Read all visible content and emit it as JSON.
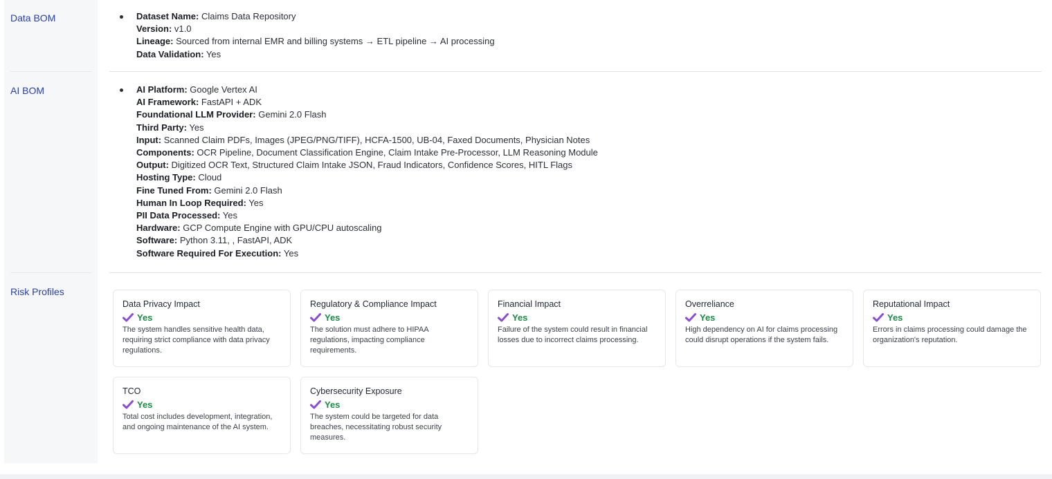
{
  "sections": {
    "data_bom_label": "Data BOM",
    "ai_bom_label": "AI BOM",
    "risk_profiles_label": "Risk Profiles"
  },
  "data_bom": [
    {
      "key": "Dataset Name:",
      "value": " Claims Data Repository"
    },
    {
      "key": "Version:",
      "value": " v1.0"
    },
    {
      "key": "Lineage:",
      "value": " Sourced from internal EMR and billing systems → ETL pipeline → AI processing"
    },
    {
      "key": "Data Validation:",
      "value": " Yes"
    }
  ],
  "ai_bom": [
    {
      "key": "AI Platform:",
      "value": " Google Vertex AI"
    },
    {
      "key": "AI Framework:",
      "value": " FastAPI + ADK"
    },
    {
      "key": "Foundational LLM Provider:",
      "value": " Gemini 2.0 Flash"
    },
    {
      "key": "Third Party:",
      "value": " Yes"
    },
    {
      "key": "Input:",
      "value": " Scanned Claim PDFs, Images (JPEG/PNG/TIFF), HCFA-1500, UB-04, Faxed Documents, Physician Notes"
    },
    {
      "key": "Components:",
      "value": " OCR Pipeline, Document Classification Engine, Claim Intake Pre-Processor, LLM Reasoning Module"
    },
    {
      "key": "Output:",
      "value": " Digitized OCR Text, Structured Claim Intake JSON, Fraud Indicators, Confidence Scores, HITL Flags"
    },
    {
      "key": "Hosting Type:",
      "value": " Cloud"
    },
    {
      "key": "Fine Tuned From:",
      "value": " Gemini 2.0 Flash"
    },
    {
      "key": "Human In Loop Required:",
      "value": " Yes"
    },
    {
      "key": "PII Data Processed:",
      "value": " Yes"
    },
    {
      "key": "Hardware:",
      "value": " GCP Compute Engine with GPU/CPU autoscaling"
    },
    {
      "key": "Software:",
      "value": " Python 3.11, , FastAPI, ADK"
    },
    {
      "key": "Software Required For Execution:",
      "value": " Yes"
    }
  ],
  "risk_profiles": [
    {
      "title": "Data Privacy Impact",
      "status": "Yes",
      "desc": "The system handles sensitive health data, requiring strict compliance with data privacy regulations."
    },
    {
      "title": "Regulatory & Compliance Impact",
      "status": "Yes",
      "desc": "The solution must adhere to HIPAA regulations, impacting compliance requirements."
    },
    {
      "title": "Financial Impact",
      "status": "Yes",
      "desc": "Failure of the system could result in financial losses due to incorrect claims processing."
    },
    {
      "title": "Overreliance",
      "status": "Yes",
      "desc": "High dependency on AI for claims processing could disrupt operations if the system fails."
    },
    {
      "title": "Reputational Impact",
      "status": "Yes",
      "desc": "Errors in claims processing could damage the organization's reputation."
    },
    {
      "title": "TCO",
      "status": "Yes",
      "desc": "Total cost includes development, integration, and ongoing maintenance of the AI system."
    },
    {
      "title": "Cybersecurity Exposure",
      "status": "Yes",
      "desc": "The system could be targeted for data breaches, necessitating robust security measures."
    }
  ],
  "colors": {
    "section_label": "#2a3fa0",
    "status_yes": "#1b8a44",
    "check_icon": "#8a4fd0"
  },
  "icons": {
    "status_icon": "check-icon"
  }
}
